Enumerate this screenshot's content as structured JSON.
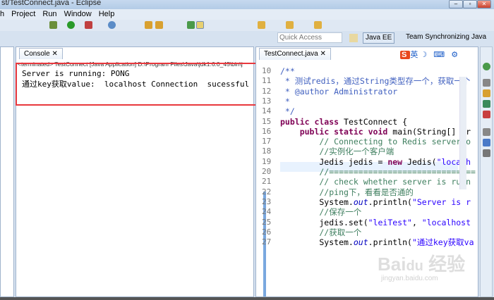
{
  "window": {
    "title": "st/TestConnect.java - Eclipse"
  },
  "menu": [
    "h",
    "Project",
    "Run",
    "Window",
    "Help"
  ],
  "quick_access": {
    "placeholder": "Quick Access"
  },
  "perspectives": [
    "Java EE",
    "Team Synchronizing",
    "Java"
  ],
  "console": {
    "tab": "Console ✕",
    "header": "<terminated> TestConnect [Java Application] D:\\Program Files\\Java\\jdk1.6.0_45\\bin\\j",
    "output": [
      "Server is running: PONG",
      "通过key获取value:  localhost Connection  sucessful"
    ]
  },
  "editor": {
    "tab": "TestConnect.java ✕",
    "ime": "英",
    "lines": [
      {
        "n": "10",
        "parts": [
          [
            "jd",
            "/**"
          ]
        ]
      },
      {
        "n": "11",
        "parts": [
          [
            "jd",
            " * 测试redis，通过String类型存一个，获取一个"
          ]
        ]
      },
      {
        "n": "12",
        "parts": [
          [
            "jd",
            " * @author Administrator"
          ]
        ]
      },
      {
        "n": "13",
        "parts": [
          [
            "jd",
            " *"
          ]
        ]
      },
      {
        "n": "14",
        "parts": [
          [
            "jd",
            " */"
          ]
        ]
      },
      {
        "n": "15",
        "parts": [
          [
            "kw",
            "public class "
          ],
          [
            "",
            "TestConnect {"
          ]
        ]
      },
      {
        "n": "16",
        "parts": [
          [
            "",
            "    "
          ],
          [
            "kw",
            "public static void "
          ],
          [
            "",
            "main(String[] ar"
          ]
        ]
      },
      {
        "n": "17",
        "parts": [
          [
            "cm",
            "        // Connecting to Redis server o"
          ]
        ]
      },
      {
        "n": "18",
        "parts": [
          [
            "cm",
            "        //实例化一个客户端"
          ]
        ]
      },
      {
        "n": "19",
        "parts": [
          [
            "",
            "        Jedis jedis = "
          ],
          [
            "kw",
            "new "
          ],
          [
            "",
            "Jedis("
          ],
          [
            "st",
            "\"localh"
          ]
        ]
      },
      {
        "n": "20",
        "parts": [
          [
            "cm",
            "        //=============================="
          ]
        ]
      },
      {
        "n": "21",
        "parts": [
          [
            "cm",
            "        // check whether server is runn"
          ]
        ]
      },
      {
        "n": "22",
        "parts": [
          [
            "cm",
            "        //ping下，看看是否通的"
          ]
        ]
      },
      {
        "n": "23",
        "parts": [
          [
            "",
            "        System."
          ],
          [
            "it",
            "out"
          ],
          [
            "",
            ".println("
          ],
          [
            "st",
            "\"Server is r"
          ]
        ]
      },
      {
        "n": "24",
        "parts": [
          [
            "cm",
            "        //保存一个"
          ]
        ]
      },
      {
        "n": "25",
        "parts": [
          [
            "",
            "        jedis.set("
          ],
          [
            "st",
            "\"leiTest\""
          ],
          [
            "",
            ", "
          ],
          [
            "st",
            "\"localhost"
          ]
        ]
      },
      {
        "n": "26",
        "parts": [
          [
            "cm",
            "        //获取一个"
          ]
        ]
      },
      {
        "n": "27",
        "parts": [
          [
            "",
            "        System."
          ],
          [
            "it",
            "out"
          ],
          [
            "",
            ".println("
          ],
          [
            "st",
            "\"通过key获取va"
          ]
        ]
      }
    ]
  },
  "watermark": {
    "logo": "Bai du 经验",
    "url": "jingyan.baidu.com"
  }
}
